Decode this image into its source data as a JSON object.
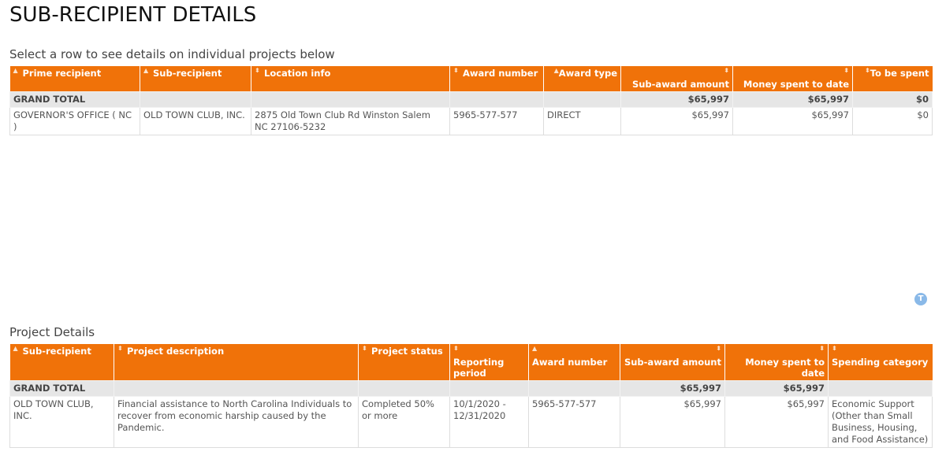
{
  "page": {
    "title": "SUB-RECIPIENT DETAILS",
    "subtitle": "Select a row to see details on individual projects below"
  },
  "subrecipients_table": {
    "headers": [
      {
        "label": "Prime recipient",
        "sort": "▲"
      },
      {
        "label": "Sub-recipient",
        "sort": "▲"
      },
      {
        "label": "Location info",
        "sort": "⬍"
      },
      {
        "label": "Award number",
        "sort": "⬍"
      },
      {
        "label": "Award type",
        "sort": "▲"
      },
      {
        "label": "Sub-award amount",
        "sort": "⬍"
      },
      {
        "label": "Money spent to date",
        "sort": "⬍"
      },
      {
        "label": "To be spent",
        "sort": "⬍"
      }
    ],
    "total_row": [
      "GRAND TOTAL",
      "",
      "",
      "",
      "",
      "$65,997",
      "$65,997",
      "$0"
    ],
    "rows": [
      [
        "GOVERNOR'S OFFICE ( NC )",
        "OLD TOWN CLUB, INC.",
        "2875 Old Town Club Rd Winston Salem NC 27106-5232",
        "5965-577-577",
        "DIRECT",
        "$65,997",
        "$65,997",
        "$0"
      ]
    ]
  },
  "filter_button": {
    "icon": "filter-icon",
    "glyph": "T"
  },
  "project_details": {
    "title": "Project Details",
    "headers": [
      {
        "label": "Sub-recipient",
        "sort": "▲"
      },
      {
        "label": "Project description",
        "sort": "⬍"
      },
      {
        "label": "Project status",
        "sort": "⬍"
      },
      {
        "label": "Reporting period",
        "sort": "⬍"
      },
      {
        "label": "Award number",
        "sort": "▲"
      },
      {
        "label": "Sub-award amount",
        "sort": "⬍"
      },
      {
        "label": "Money spent to date",
        "sort": "⬍"
      },
      {
        "label": "Spending category",
        "sort": "⬍"
      }
    ],
    "total_row": [
      "GRAND TOTAL",
      "",
      "",
      "",
      "",
      "$65,997",
      "$65,997",
      ""
    ],
    "rows": [
      [
        "OLD TOWN CLUB, INC.",
        "Financial assistance to North Carolina Individuals to recover from economic harship caused by the Pandemic.",
        "Completed 50% or more",
        "10/1/2020 - 12/31/2020",
        "5965-577-577",
        "$65,997",
        "$65,997",
        "Economic Support (Other than Small Business, Housing, and Food Assistance)"
      ]
    ]
  }
}
